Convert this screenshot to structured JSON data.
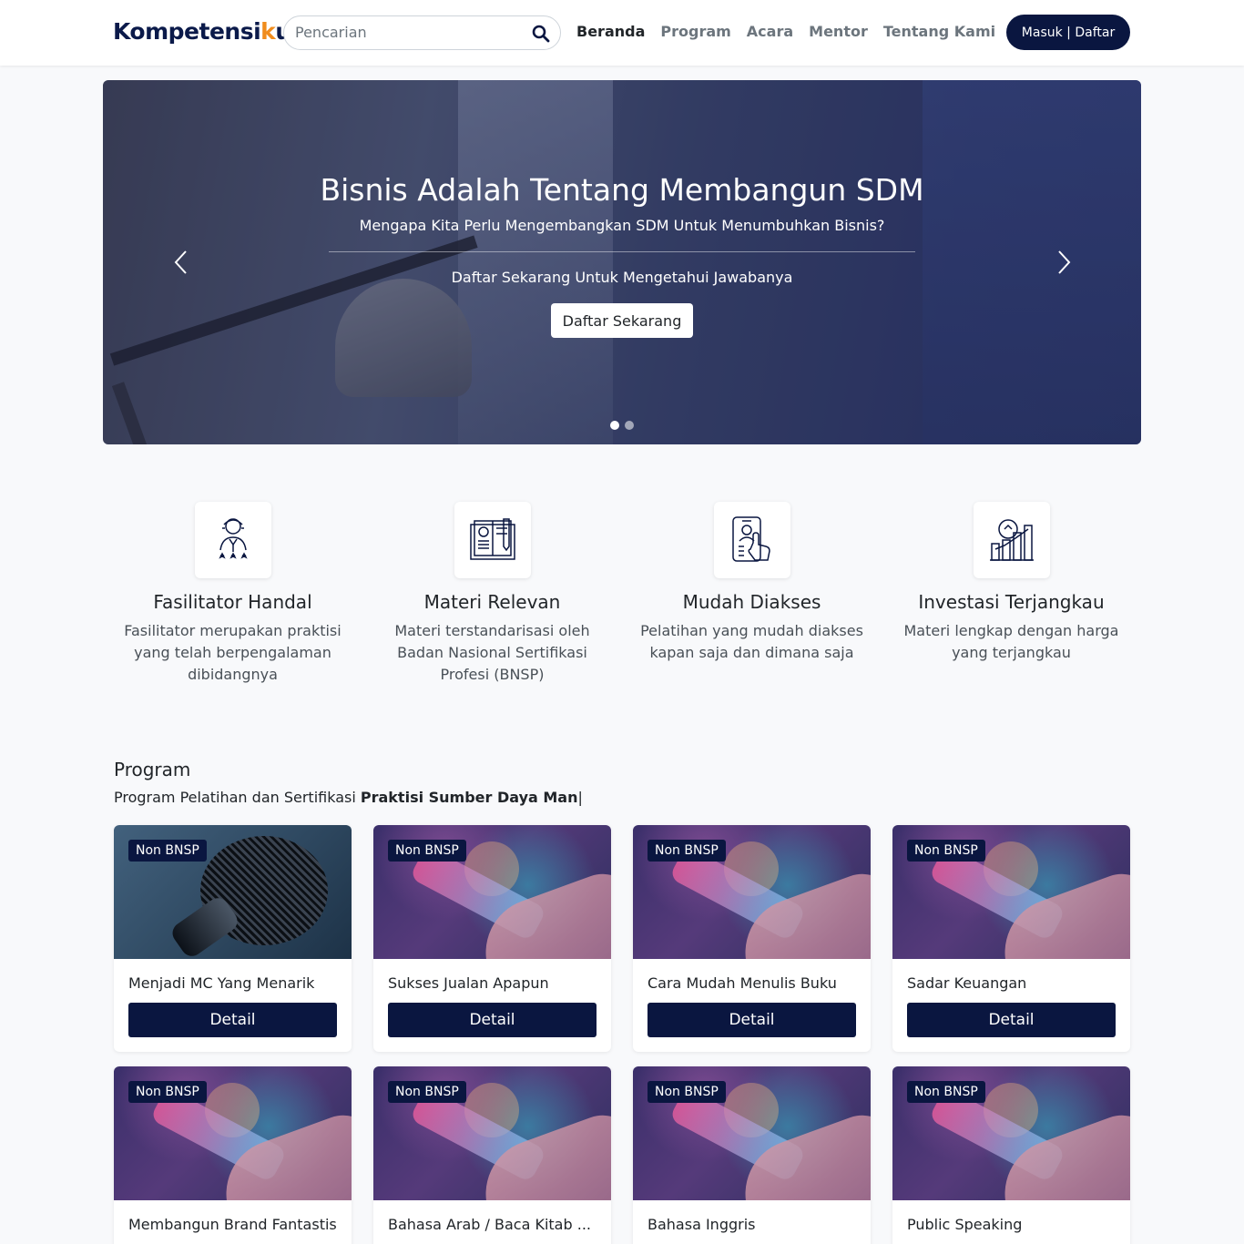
{
  "navbar": {
    "logo_main": "Kompetensi",
    "logo_k": "k",
    "logo_end": "u",
    "search_placeholder": "Pencarian",
    "links": [
      "Beranda",
      "Program",
      "Acara",
      "Mentor",
      "Tentang Kami"
    ],
    "active_link": "Beranda",
    "login_label": "Masuk | Daftar",
    "brand_color": "#0a1640",
    "accent_color": "#f08c1c"
  },
  "hero": {
    "title": "Bisnis Adalah Tentang Membangun SDM",
    "subtitle": "Mengapa Kita Perlu Mengembangkan SDM Untuk Menumbuhkan Bisnis?",
    "cta_text": "Daftar Sekarang Untuk Mengetahui Jawabanya",
    "cta_button": "Daftar Sekarang",
    "slide_count": 2,
    "active_slide": 1
  },
  "features": [
    {
      "icon": "facilitator-icon",
      "title": "Fasilitator Handal",
      "desc": "Fasilitator merupakan praktisi yang telah berpengalaman dibidangnya"
    },
    {
      "icon": "book-icon",
      "title": "Materi Relevan",
      "desc": "Materi terstandarisasi oleh Badan Nasional Sertifikasi Profesi (BNSP)"
    },
    {
      "icon": "mobile-access-icon",
      "title": "Mudah Diakses",
      "desc": "Pelatihan yang mudah diakses kapan saja dan dimana saja"
    },
    {
      "icon": "investment-chart-icon",
      "title": "Investasi Terjangkau",
      "desc": "Materi lengkap dengan harga yang terjangkau"
    }
  ],
  "program": {
    "title": "Program",
    "subtitle_prefix": "Program Pelatihan dan Sertifikasi ",
    "subtitle_bold": "Praktisi Sumber Daya Man",
    "cursor": "|",
    "detail_label": "Detail",
    "cards": [
      {
        "badge": "Non BNSP",
        "title": "Menjadi MC Yang Menarik",
        "image": "microphone"
      },
      {
        "badge": "Non BNSP",
        "title": "Sukses Jualan Apapun",
        "image": "tech-phone"
      },
      {
        "badge": "Non BNSP",
        "title": "Cara Mudah Menulis Buku",
        "image": "tech-phone"
      },
      {
        "badge": "Non BNSP",
        "title": "Sadar Keuangan",
        "image": "tech-phone"
      },
      {
        "badge": "Non BNSP",
        "title": "Membangun Brand Fantastis",
        "image": "tech-phone"
      },
      {
        "badge": "Non BNSP",
        "title": "Bahasa Arab / Baca Kitab ...",
        "image": "tech-phone"
      },
      {
        "badge": "Non BNSP",
        "title": "Bahasa Inggris",
        "image": "tech-phone"
      },
      {
        "badge": "Non BNSP",
        "title": "Public Speaking",
        "image": "tech-phone"
      }
    ]
  }
}
